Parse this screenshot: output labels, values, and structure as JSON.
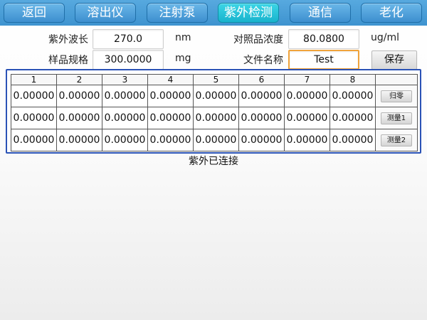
{
  "tabs": [
    {
      "label": "返回",
      "active": false
    },
    {
      "label": "溶出仪",
      "active": false
    },
    {
      "label": "注射泵",
      "active": false
    },
    {
      "label": "紫外检测",
      "active": true
    },
    {
      "label": "通信",
      "active": false
    },
    {
      "label": "老化",
      "active": false
    }
  ],
  "form": {
    "wavelength_label": "紫外波长",
    "wavelength_value": "270.0",
    "wavelength_unit": "nm",
    "sample_spec_label": "样品规格",
    "sample_spec_value": "300.0000",
    "sample_spec_unit": "mg",
    "ref_conc_label": "对照品浓度",
    "ref_conc_value": "80.0800",
    "ref_conc_unit": "ug/ml",
    "filename_label": "文件名称",
    "filename_value": "Test",
    "save_label": "保存"
  },
  "table": {
    "headers": [
      "1",
      "2",
      "3",
      "4",
      "5",
      "6",
      "7",
      "8"
    ],
    "rows": [
      {
        "cells": [
          "0.00000",
          "0.00000",
          "0.00000",
          "0.00000",
          "0.00000",
          "0.00000",
          "0.00000",
          "0.00000"
        ],
        "action": "归零"
      },
      {
        "cells": [
          "0.00000",
          "0.00000",
          "0.00000",
          "0.00000",
          "0.00000",
          "0.00000",
          "0.00000",
          "0.00000"
        ],
        "action": "测量1"
      },
      {
        "cells": [
          "0.00000",
          "0.00000",
          "0.00000",
          "0.00000",
          "0.00000",
          "0.00000",
          "0.00000",
          "0.00000"
        ],
        "action": "测量2"
      }
    ]
  },
  "status": "紫外已连接",
  "colors": {
    "tab_bar": "#4a9fd8",
    "active_tab": "#22c0d6",
    "table_border": "#2a52b6",
    "focus_border": "#f0a33b"
  }
}
